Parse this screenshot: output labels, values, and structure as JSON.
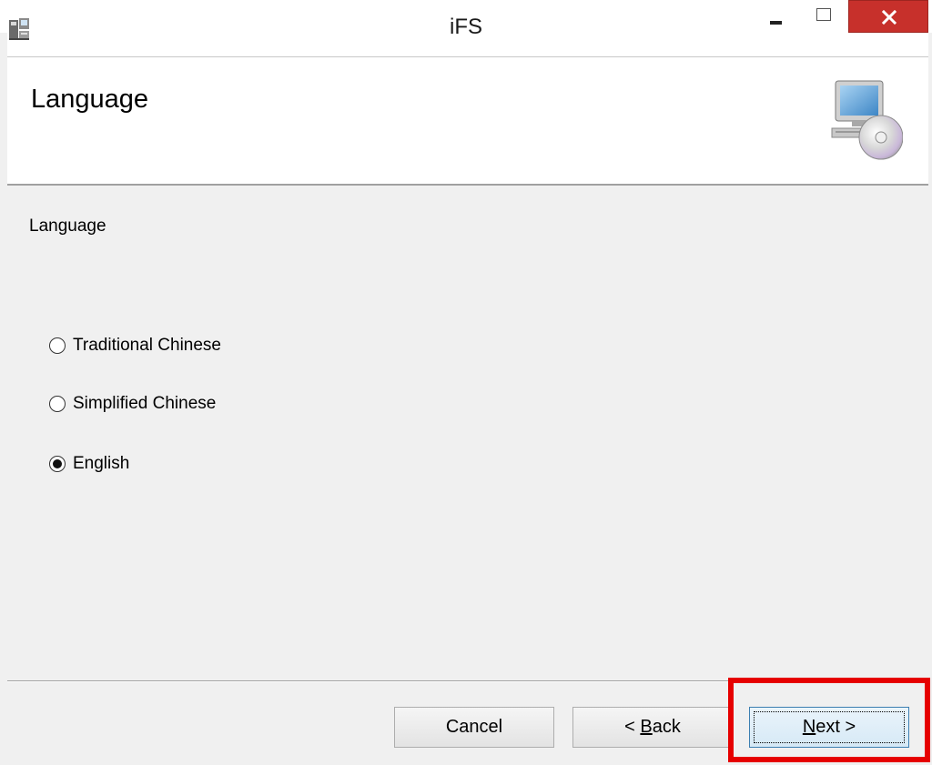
{
  "window": {
    "title": "iFS",
    "close_symbol": "✕"
  },
  "header": {
    "title": "Language"
  },
  "body": {
    "section_label": "Language",
    "options": [
      {
        "label": "Traditional Chinese",
        "checked": false
      },
      {
        "label": "Simplified Chinese",
        "checked": false
      },
      {
        "label": "English",
        "checked": true
      }
    ]
  },
  "footer": {
    "cancel_label": "Cancel",
    "back_prefix": "< ",
    "back_mnemonic": "B",
    "back_rest": "ack",
    "next_mnemonic": "N",
    "next_rest": "ext >"
  },
  "colors": {
    "close_button": "#c7302b",
    "highlight": "#e60000",
    "next_border": "#3c7fb1"
  },
  "icons": {
    "app": "installer-icon",
    "setup": "computer-cd-icon"
  }
}
